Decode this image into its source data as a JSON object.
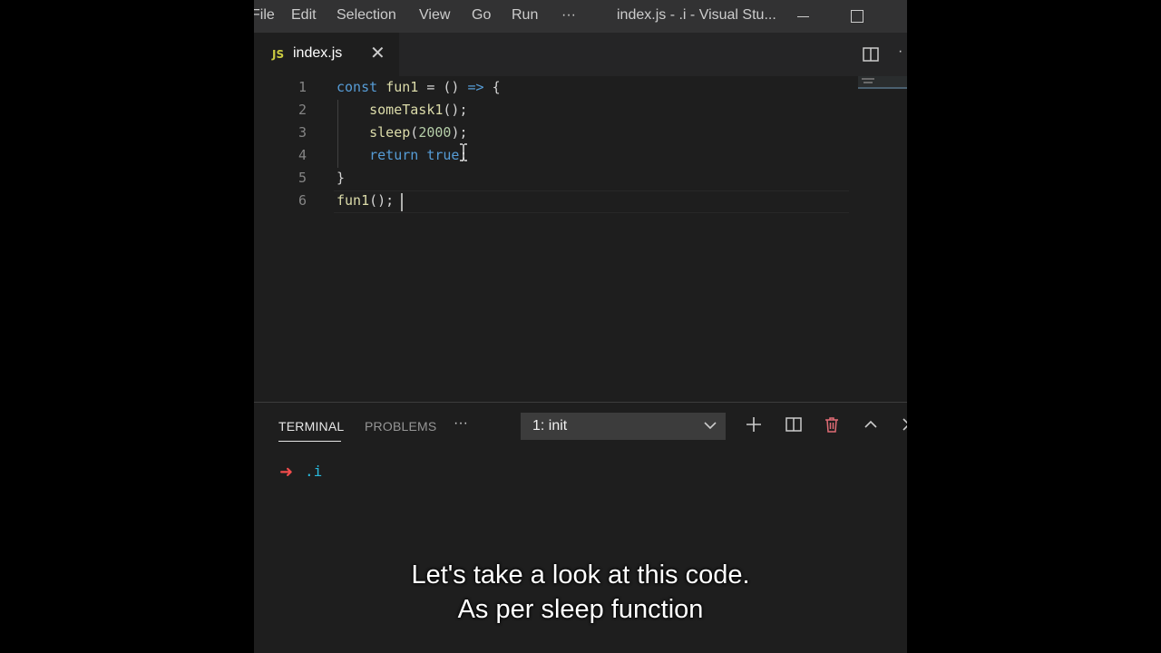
{
  "titlebar": {
    "menu": [
      "File",
      "Edit",
      "Selection",
      "View",
      "Go",
      "Run",
      "···"
    ],
    "window_title": "index.js - .i - Visual Stu..."
  },
  "tab": {
    "icon_text": "JS",
    "label": "index.js",
    "close_glyph": "✕"
  },
  "editor": {
    "line_numbers": [
      "1",
      "2",
      "3",
      "4",
      "5",
      "6"
    ],
    "lines": [
      {
        "kw": "const ",
        "fn": "fun1",
        "rest": " = () ",
        "kwb": "=>",
        "tail": " {"
      },
      {
        "indent": "    ",
        "fn": "someTask1",
        "rest": "();"
      },
      {
        "indent": "    ",
        "fn": "sleep",
        "open": "(",
        "num": "2000",
        "close": ");"
      },
      {
        "indent": "    ",
        "kw": "return ",
        "kwb": "true",
        "rest": ";"
      },
      {
        "text": "}"
      },
      {
        "fn": "fun1",
        "rest": "();"
      }
    ]
  },
  "panel": {
    "tabs": [
      "TERMINAL",
      "PROBLEMS"
    ],
    "more": "···",
    "terminal_select": "1: init",
    "prompt_arrow": "➜",
    "prompt_dir": ".i"
  },
  "subtitles": [
    "Let's take a look at this code.",
    "As per sleep function"
  ],
  "colors": {
    "keyword": "#569cd6",
    "function": "#dcdcaa",
    "number": "#b5cea8",
    "prompt_arrow": "#f14c4c",
    "prompt_dir": "#29b8db"
  }
}
